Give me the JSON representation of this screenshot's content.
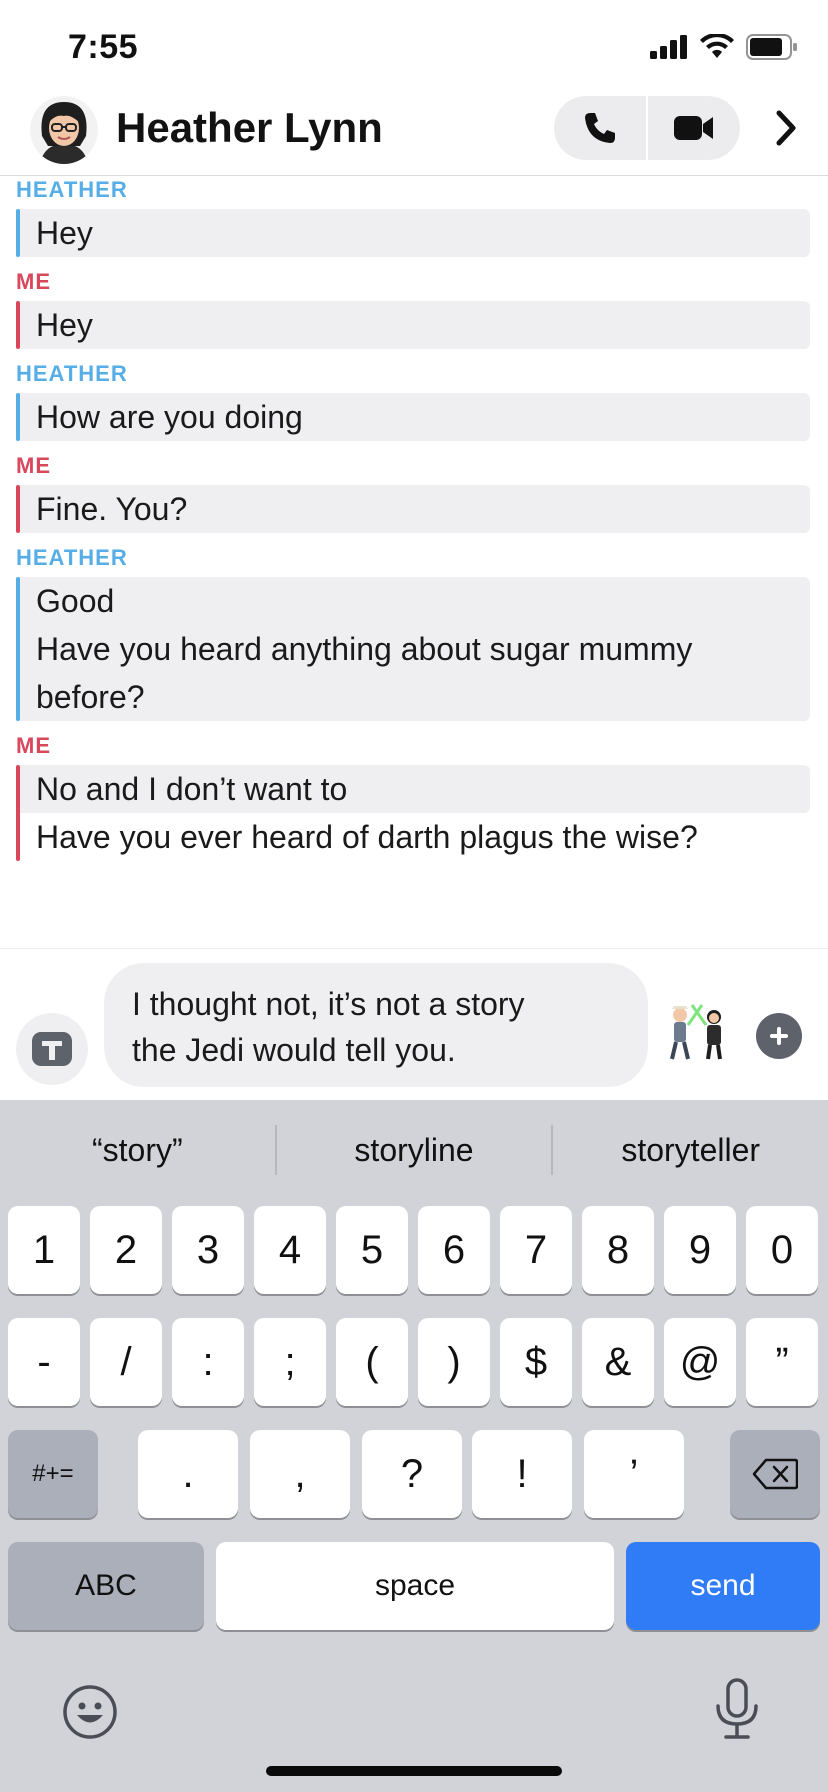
{
  "status_bar": {
    "time": "7:55"
  },
  "header": {
    "contact_name": "Heather Lynn",
    "call_icon": "phone-icon",
    "video_icon": "video-camera-icon",
    "more_icon": "chevron-right-icon"
  },
  "messages": [
    {
      "sender": "HEATHER",
      "from": "heather",
      "lines": [
        "Hey"
      ]
    },
    {
      "sender": "ME",
      "from": "me",
      "lines": [
        "Hey"
      ]
    },
    {
      "sender": "HEATHER",
      "from": "heather",
      "lines": [
        "How are you doing"
      ]
    },
    {
      "sender": "ME",
      "from": "me",
      "lines": [
        "Fine. You?"
      ]
    },
    {
      "sender": "HEATHER",
      "from": "heather",
      "lines": [
        "Good",
        "Have you heard anything about sugar mummy",
        "before?"
      ]
    },
    {
      "sender": "ME",
      "from": "me",
      "lines": [
        "No and I don’t want to",
        "Have you ever heard of darth plagus the wise?"
      ]
    }
  ],
  "composer": {
    "text_value": "I thought not, it’s not a story\nthe Jedi would tell you.",
    "text_icon": "text-t-icon",
    "bitmoji_icon": "bitmoji-sticker-icon",
    "plus_icon": "plus-icon"
  },
  "keyboard": {
    "suggestions": [
      "“story”",
      "storyline",
      "storyteller"
    ],
    "row1": [
      "1",
      "2",
      "3",
      "4",
      "5",
      "6",
      "7",
      "8",
      "9",
      "0"
    ],
    "row2": [
      "-",
      "/",
      ":",
      ";",
      "(",
      ")",
      "$",
      "&",
      "@",
      "”"
    ],
    "row3": {
      "symbols_label": "#+=",
      "keys": [
        ".",
        ",",
        "?",
        "!",
        "’"
      ],
      "delete_icon": "backspace-icon"
    },
    "row4": {
      "abc_label": "ABC",
      "space_label": "space",
      "send_label": "send"
    },
    "emoji_icon": "emoji-icon",
    "mic_icon": "microphone-icon"
  },
  "colors": {
    "heather": "#57aee7",
    "me": "#d8485a",
    "send_key": "#2f7cf6",
    "keyboard_bg": "#d1d3d9"
  }
}
